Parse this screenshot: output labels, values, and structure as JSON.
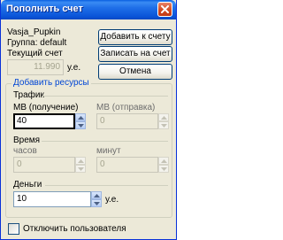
{
  "window": {
    "title": "Пополнить счет",
    "close_icon": "close-icon"
  },
  "user": {
    "name": "Vasja_Pupkin",
    "group": "Группа: default",
    "balance_label": "Текущий счет",
    "balance_value": "11.990",
    "currency": "у.е."
  },
  "buttons": {
    "add": "Добавить к счету",
    "write": "Записать на счет",
    "cancel": "Отмена"
  },
  "resources": {
    "title": "Добавить ресурсы",
    "traffic": {
      "title": "Трафик",
      "received_label": "MB (получение)",
      "received_value": "40",
      "sent_label": "MB (отправка)",
      "sent_value": "0"
    },
    "time": {
      "title": "Время",
      "hours_label": "часов",
      "hours_value": "0",
      "minutes_label": "минут",
      "minutes_value": "0"
    },
    "money": {
      "title": "Деньги",
      "value": "10",
      "currency": "у.е."
    }
  },
  "disable_user": {
    "label": "Отключить пользователя",
    "checked": false
  }
}
